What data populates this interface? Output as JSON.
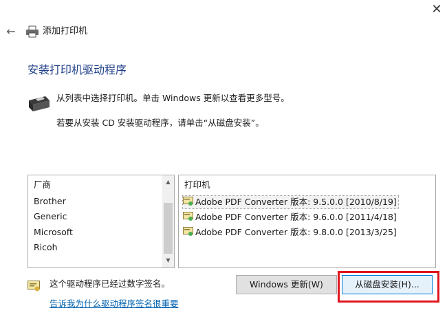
{
  "window": {
    "title": "添加打印机",
    "close_icon": "close-icon",
    "back_icon": "back-arrow-icon",
    "printer_icon": "printer-icon"
  },
  "heading": "安装打印机驱动程序",
  "instructions": {
    "line1": "从列表中选择打印机。单击 Windows 更新以查看更多型号。",
    "line2": "若要从安装 CD 安装驱动程序，请单击“从磁盘安装”。"
  },
  "manufacturer_list": {
    "header": "厂商",
    "items": [
      "Brother",
      "Generic",
      "Microsoft",
      "Ricoh"
    ]
  },
  "printer_list": {
    "header": "打印机",
    "items": [
      "Adobe PDF Converter 版本: 9.5.0.0 [2010/8/19]",
      "Adobe PDF Converter 版本: 9.6.0.0 [2011/4/18]",
      "Adobe PDF Converter 版本: 9.8.0.0 [2013/3/25]"
    ],
    "selected_index": 0
  },
  "signature": {
    "text": "这个驱动程序已经过数字签名。",
    "link": "告诉我为什么驱动程序签名很重要"
  },
  "buttons": {
    "windows_update": "Windows 更新(W)",
    "have_disk": "从磁盘安装(H)..."
  },
  "colors": {
    "heading": "#1e3f8a",
    "link": "#0063b1",
    "highlight": "#e0141e"
  }
}
